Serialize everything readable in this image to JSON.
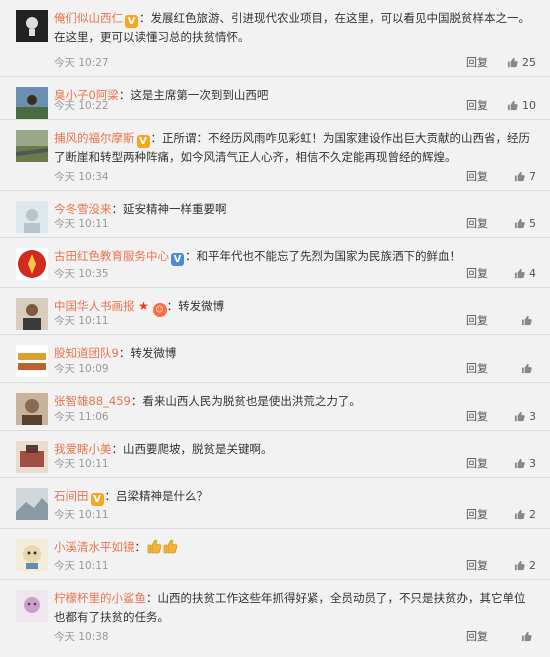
{
  "comments": [
    {
      "user": "俺们似山西仁",
      "badge": "V",
      "text": "：发展红色旅游、引进现代农业项目，在这里，可以看见中国脱贫样本之一。在这里，更可以读懂习总的扶贫情怀。",
      "time": "今天 10:27",
      "reply": "回复",
      "likes": "25",
      "avatar_color": "#222"
    },
    {
      "user": "臭小子0阿梁",
      "badge": "",
      "text": "：这是主席第一次到到山西吧",
      "time": "今天 10:22",
      "reply": "回复",
      "likes": "10",
      "avatar_color": "#6a8fb0"
    },
    {
      "user": "捕风的福尔摩斯",
      "badge": "V",
      "text": "：正所谓：不经历风雨咋见彩虹！为国家建设作出巨大贡献的山西省，经历了断崖和转型两种阵痛，如今风清气正人心齐，相信不久定能再现曾经的辉煌。",
      "time": "今天 10:34",
      "reply": "回复",
      "likes": "7",
      "avatar_color": "#7b8a5a"
    },
    {
      "user": "今冬雪没来",
      "badge": "",
      "text": "：延安精神一样重要啊",
      "time": "今天 10:11",
      "reply": "回复",
      "likes": "5",
      "avatar_color": "#cfd8e0"
    },
    {
      "user": "古田红色教育服务中心",
      "badge": "V",
      "text": "：和平年代也不能忘了先烈为国家为民族洒下的鲜血！",
      "time": "今天 10:35",
      "reply": "回复",
      "likes": "4",
      "avatar_color": "#d22a1f"
    },
    {
      "user": "中国华人书画报",
      "badge": "",
      "text": "：转发微博",
      "time": "今天 10:11",
      "reply": "回复",
      "likes": "",
      "avatar_color": "#9a7a64"
    },
    {
      "user": "股知道团队9",
      "badge": "",
      "text": "：转发微博",
      "time": "今天 10:09",
      "reply": "回复",
      "likes": "",
      "avatar_color": "#d9a030"
    },
    {
      "user": "张智雄88_459",
      "badge": "",
      "text": "：看来山西人民为脱贫也是使出洪荒之力了。",
      "time": "今天 11:06",
      "reply": "回复",
      "likes": "3",
      "avatar_color": "#8a6a50"
    },
    {
      "user": "我爱瞎小美",
      "badge": "",
      "text": "：山西要爬坡，脱贫是关键啊。",
      "time": "今天 10:11",
      "reply": "回复",
      "likes": "3",
      "avatar_color": "#a05040"
    },
    {
      "user": "石间田",
      "badge": "V",
      "text": "：吕梁精神是什么？",
      "time": "今天 10:11",
      "reply": "回复",
      "likes": "2",
      "avatar_color": "#b0b8c0"
    },
    {
      "user": "小溪清水平如镜",
      "badge": "",
      "text": "：",
      "time": "今天 10:11",
      "reply": "回复",
      "likes": "2",
      "avatar_color": "#e8d8b0"
    },
    {
      "user": "柠檬杯里的小鲨鱼",
      "badge": "",
      "text": "：山西的扶贫工作这些年抓得好紧，全员动员了，不只是扶贫办，其它单位也都有了扶贫的任务。",
      "time": "今天 10:38",
      "reply": "回复",
      "likes": "",
      "avatar_color": "#c8a0c8"
    }
  ],
  "colors": {
    "username": "#eb7350",
    "time": "#999999",
    "badge_gold": "#f5a623",
    "badge_blue": "#4b8cd6"
  },
  "icons": {
    "like": "thumbs-up-icon",
    "verified": "verified-v-icon"
  }
}
